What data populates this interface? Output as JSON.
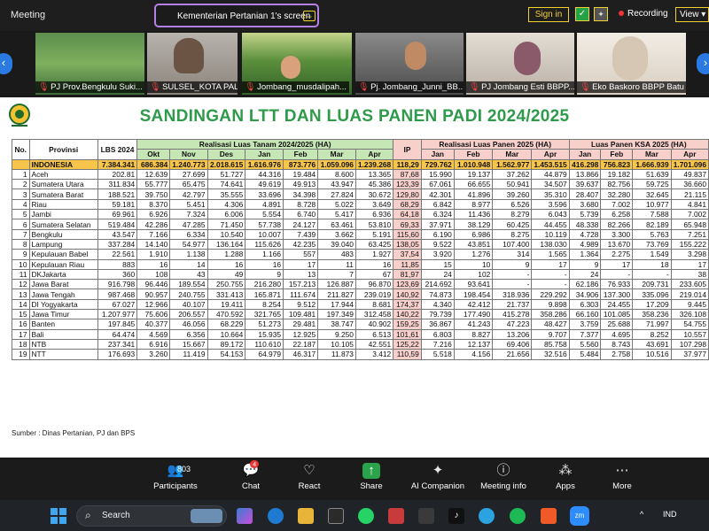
{
  "topbar": {
    "meeting_label": "Meeting",
    "share_label": "Kementerian Pertanian 1's screen",
    "signin_label": "Sign in",
    "recording_label": "Recording",
    "view_label": "View"
  },
  "participants": [
    {
      "name": "PJ Prov.Bengkulu Suki..."
    },
    {
      "name": "SULSEL_KOTA PALOP..."
    },
    {
      "name": "Jombang_musdalipah..."
    },
    {
      "name": "Pj. Jombang_Junni_BB..."
    },
    {
      "name": "PJ Jombang Esti BBPP..."
    },
    {
      "name": "Eko Baskoro BBPP Batu"
    }
  ],
  "slide": {
    "title": "SANDINGAN LTT DAN LUAS PANEN PADI 2024/2025",
    "source": "Sumber : Dinas Pertanian, PJ dan BPS",
    "headers": {
      "no": "No.",
      "provinsi": "Provinsi",
      "lbs": "LBS 2024",
      "realisasi_tanam": "Realisasi Luas Tanam 2024/2025 (HA)",
      "ip": "IP",
      "realisasi_panen": "Realisasi Luas Panen 2025 (HA)",
      "ksa": "Luas Panen KSA 2025 (HA)",
      "tanam_months": [
        "Okt",
        "Nov",
        "Des",
        "Jan",
        "Feb",
        "Mar",
        "Apr"
      ],
      "panen_months": [
        "Jan",
        "Feb",
        "Mar",
        "Apr"
      ],
      "ksa_months": [
        "Jan",
        "Feb",
        "Mar",
        "Apr"
      ]
    },
    "total": {
      "name": "INDONESIA",
      "lbs": "7.384.341",
      "tanam": [
        "686.384",
        "1.240.773",
        "2.018.615",
        "1.616.976",
        "873.776",
        "1.059.096",
        "1.239.268"
      ],
      "ip": "118,29",
      "panen": [
        "729.762",
        "1.010.948",
        "1.562.977",
        "1.453.515"
      ],
      "ksa": [
        "416.298",
        "756.823",
        "1.666.939",
        "1.701.096"
      ]
    },
    "rows": [
      {
        "no": "1",
        "name": "Aceh",
        "lbs": "202.81",
        "tanam": [
          "12.639",
          "27.699",
          "51.727",
          "44.316",
          "19.484",
          "8.600",
          "13.365"
        ],
        "ip": "87,68",
        "panen": [
          "15.990",
          "19.137",
          "37.262",
          "44.879"
        ],
        "ksa": [
          "13.866",
          "19.182",
          "51.639",
          "49.837"
        ]
      },
      {
        "no": "2",
        "name": "Sumatera Utara",
        "lbs": "311.834",
        "tanam": [
          "55.777",
          "65.475",
          "74.641",
          "49.619",
          "49.913",
          "43.947",
          "45.386"
        ],
        "ip": "123,39",
        "panen": [
          "67.061",
          "66.655",
          "50.941",
          "34.507"
        ],
        "ksa": [
          "39.637",
          "82.756",
          "59.725",
          "36.660"
        ]
      },
      {
        "no": "3",
        "name": "Sumatera Barat",
        "lbs": "188.521",
        "tanam": [
          "39.750",
          "42.797",
          "35.555",
          "33.696",
          "34.398",
          "27.824",
          "30.672"
        ],
        "ip": "129,80",
        "panen": [
          "42.301",
          "41.896",
          "39.260",
          "35.310"
        ],
        "ksa": [
          "28.407",
          "32.280",
          "32.645",
          "21.115"
        ]
      },
      {
        "no": "4",
        "name": "Riau",
        "lbs": "59.181",
        "tanam": [
          "8.370",
          "5.451",
          "4.306",
          "4.891",
          "8.728",
          "5.022",
          "3.649"
        ],
        "ip": "68,29",
        "panen": [
          "6.842",
          "8.977",
          "6.526",
          "3.596"
        ],
        "ksa": [
          "3.680",
          "7.002",
          "10.977",
          "4.841"
        ]
      },
      {
        "no": "5",
        "name": "Jambi",
        "lbs": "69.961",
        "tanam": [
          "6.926",
          "7.324",
          "6.006",
          "5.554",
          "6.740",
          "5.417",
          "6.936"
        ],
        "ip": "64,18",
        "panen": [
          "6.324",
          "11.436",
          "8.279",
          "6.043"
        ],
        "ksa": [
          "5.739",
          "6.258",
          "7.588",
          "7.002"
        ]
      },
      {
        "no": "6",
        "name": "Sumatera Selatan",
        "lbs": "519.484",
        "tanam": [
          "42.286",
          "47.285",
          "71.450",
          "57.738",
          "24.127",
          "63.461",
          "53.810"
        ],
        "ip": "69,33",
        "panen": [
          "37.971",
          "38.129",
          "60.425",
          "44.455"
        ],
        "ksa": [
          "48.338",
          "82.266",
          "82.189",
          "65.948"
        ]
      },
      {
        "no": "7",
        "name": "Bengkulu",
        "lbs": "43.547",
        "tanam": [
          "7.166",
          "6.334",
          "10.540",
          "10.007",
          "7.439",
          "3.662",
          "5.191"
        ],
        "ip": "115,60",
        "panen": [
          "6.190",
          "6.986",
          "8.275",
          "10.119"
        ],
        "ksa": [
          "4.728",
          "3.300",
          "5.763",
          "7.251"
        ]
      },
      {
        "no": "8",
        "name": "Lampung",
        "lbs": "337.284",
        "tanam": [
          "14.140",
          "54.977",
          "136.164",
          "115.626",
          "42.235",
          "39.040",
          "63.425"
        ],
        "ip": "138,05",
        "panen": [
          "9.522",
          "43.851",
          "107.400",
          "138.030"
        ],
        "ksa": [
          "4.989",
          "13.670",
          "73.769",
          "155.222"
        ]
      },
      {
        "no": "9",
        "name": "Kepulauan Babel",
        "lbs": "22.561",
        "tanam": [
          "1.910",
          "1.138",
          "1.288",
          "1.166",
          "557",
          "483",
          "1.927"
        ],
        "ip": "37,54",
        "panen": [
          "3.920",
          "1.276",
          "314",
          "1.565"
        ],
        "ksa": [
          "1.364",
          "2.275",
          "1.549",
          "3.298"
        ]
      },
      {
        "no": "10",
        "name": "Kepulauan Riau",
        "lbs": "883",
        "tanam": [
          "16",
          "14",
          "16",
          "16",
          "17",
          "11",
          "16"
        ],
        "ip": "11,85",
        "panen": [
          "15",
          "10",
          "9",
          "17"
        ],
        "ksa": [
          "9",
          "17",
          "18",
          "17"
        ]
      },
      {
        "no": "11",
        "name": "DKJakarta",
        "lbs": "360",
        "tanam": [
          "108",
          "43",
          "49",
          "9",
          "13",
          "7",
          "67"
        ],
        "ip": "81,97",
        "panen": [
          "24",
          "102",
          "-",
          "-"
        ],
        "ksa": [
          "24",
          "-",
          "-",
          "38"
        ]
      },
      {
        "no": "12",
        "name": "Jawa Barat",
        "lbs": "916.798",
        "tanam": [
          "96.446",
          "189.554",
          "250.755",
          "216.280",
          "157.213",
          "126.887",
          "96.870"
        ],
        "ip": "123,69",
        "panen": [
          "214.692",
          "93.641",
          "-",
          "-"
        ],
        "ksa": [
          "62.186",
          "76.933",
          "209.731",
          "233.605"
        ]
      },
      {
        "no": "13",
        "name": "Jawa Tengah",
        "lbs": "987.468",
        "tanam": [
          "90.957",
          "240.755",
          "331.413",
          "165.871",
          "111.674",
          "211.827",
          "239.019"
        ],
        "ip": "140,92",
        "panen": [
          "74.873",
          "198.454",
          "318.936",
          "229.292"
        ],
        "ksa": [
          "34.906",
          "137.300",
          "335.096",
          "219.014"
        ]
      },
      {
        "no": "14",
        "name": "DI Yogyakarta",
        "lbs": "67.027",
        "tanam": [
          "12.966",
          "40.107",
          "19.411",
          "8.254",
          "9.512",
          "17.944",
          "8.681"
        ],
        "ip": "174,37",
        "panen": [
          "4.340",
          "42.412",
          "21.737",
          "9.898"
        ],
        "ksa": [
          "6.303",
          "24.455",
          "17.209",
          "9.445"
        ]
      },
      {
        "no": "15",
        "name": "Jawa Timur",
        "lbs": "1.207.977",
        "tanam": [
          "75.606",
          "206.557",
          "470.592",
          "321.765",
          "109.481",
          "197.349",
          "312.458"
        ],
        "ip": "140,22",
        "panen": [
          "79.739",
          "177.490",
          "415.278",
          "358.286"
        ],
        "ksa": [
          "66.160",
          "101.085",
          "358.236",
          "326.108"
        ]
      },
      {
        "no": "16",
        "name": "Banten",
        "lbs": "197.845",
        "tanam": [
          "40.377",
          "46.056",
          "68.229",
          "51.273",
          "29.481",
          "38.747",
          "40.902"
        ],
        "ip": "159,25",
        "panen": [
          "36.867",
          "41.243",
          "47.223",
          "48.427"
        ],
        "ksa": [
          "3.759",
          "25.688",
          "71.997",
          "54.755"
        ]
      },
      {
        "no": "17",
        "name": "Bali",
        "lbs": "64.474",
        "tanam": [
          "4.569",
          "6.356",
          "10.664",
          "15.935",
          "12.925",
          "9.250",
          "6.513"
        ],
        "ip": "101,61",
        "panen": [
          "6.803",
          "8.827",
          "13.206",
          "9.707"
        ],
        "ksa": [
          "7.377",
          "4.695",
          "8.252",
          "10.557"
        ]
      },
      {
        "no": "18",
        "name": "NTB",
        "lbs": "237.341",
        "tanam": [
          "6.916",
          "15.667",
          "89.172",
          "110.610",
          "22.187",
          "10.105",
          "42.551"
        ],
        "ip": "125,22",
        "panen": [
          "7.216",
          "12.137",
          "69.406",
          "85.758"
        ],
        "ksa": [
          "5.560",
          "8.743",
          "43.691",
          "107.298"
        ]
      },
      {
        "no": "19",
        "name": "NTT",
        "lbs": "176.693",
        "tanam": [
          "3.260",
          "11.419",
          "54.153",
          "64.979",
          "46.317",
          "11.873",
          "3.412"
        ],
        "ip": "110,59",
        "panen": [
          "5.518",
          "4.156",
          "21.656",
          "32.516"
        ],
        "ksa": [
          "5.484",
          "2.758",
          "10.516",
          "37.977"
        ]
      }
    ]
  },
  "toolbar": {
    "participants_label": "Participants",
    "participants_count": "803",
    "chat_label": "Chat",
    "chat_badge": "4",
    "react_label": "React",
    "share_label": "Share",
    "ai_label": "AI Companion",
    "info_label": "Meeting info",
    "apps_label": "Apps",
    "more_label": "More"
  },
  "taskbar": {
    "search_label": "Search",
    "lang": "IND"
  },
  "colors": {
    "title_green": "#2e9a4a",
    "header_green": "#c6e6b5",
    "header_pink": "#f7cfcb",
    "total_row": "#f7c54a",
    "accent_yellow": "#f2d230",
    "share_purple": "#b580e6"
  }
}
